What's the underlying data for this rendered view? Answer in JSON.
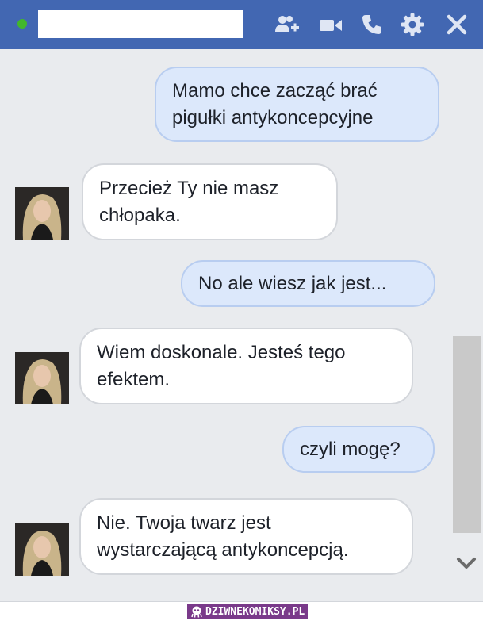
{
  "header": {
    "contact_name": "",
    "icons": [
      "add-person-icon",
      "video-camera-icon",
      "phone-icon",
      "gear-icon",
      "close-icon"
    ],
    "accent_color": "#4267b2",
    "online_color": "#42b72a"
  },
  "messages": [
    {
      "from": "me",
      "lines": [
        "Mamo chce zacząć brać",
        "pigułki antykoncepcyjne"
      ]
    },
    {
      "from": "them",
      "lines": [
        "Przecież Ty nie masz",
        "chłopaka."
      ]
    },
    {
      "from": "me",
      "lines": [
        "No ale wiesz jak jest..."
      ]
    },
    {
      "from": "them",
      "lines": [
        "Wiem doskonale. Jesteś tego",
        "efektem."
      ]
    },
    {
      "from": "me",
      "lines": [
        "czyli mogę?"
      ]
    },
    {
      "from": "them",
      "lines": [
        "Nie. Twoja twarz jest",
        "wystarczającą antykoncepcją."
      ]
    }
  ],
  "watermark": {
    "text": "DZIWNEKOMIKSY.PL",
    "icon": "octopus-icon"
  }
}
